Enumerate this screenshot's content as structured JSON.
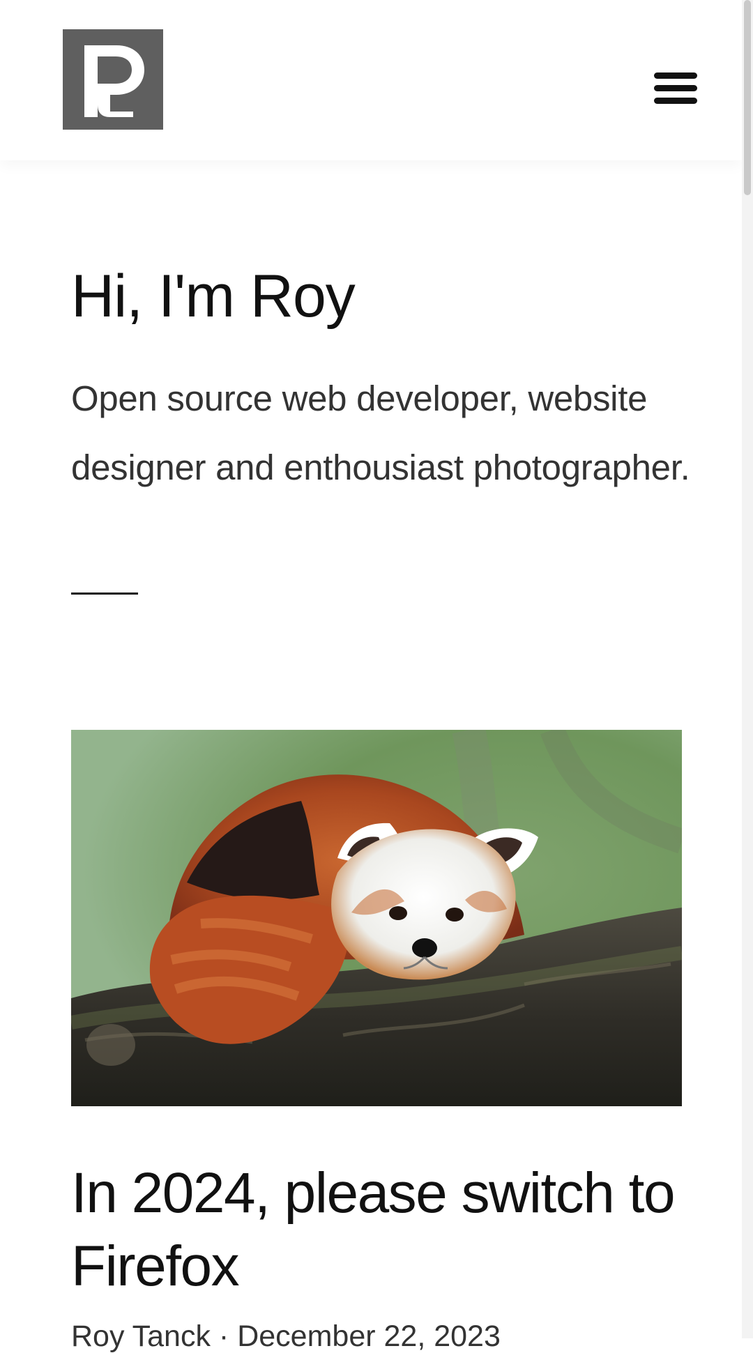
{
  "header": {
    "logo_icon": "rt-monogram-logo",
    "menu_icon": "hamburger-menu-icon"
  },
  "intro": {
    "heading": "Hi, I'm Roy",
    "description": "Open source web developer, website designer and enthousiast photographer."
  },
  "featured_post": {
    "image_subject": "red-panda-on-branch",
    "title": "In 2024, please switch to Firefox",
    "author": "Roy Tanck",
    "separator": "·",
    "date": "December 22, 2023"
  },
  "colors": {
    "logo_background": "#5f5f5f",
    "text": "#111111",
    "muted_text": "#333333"
  }
}
